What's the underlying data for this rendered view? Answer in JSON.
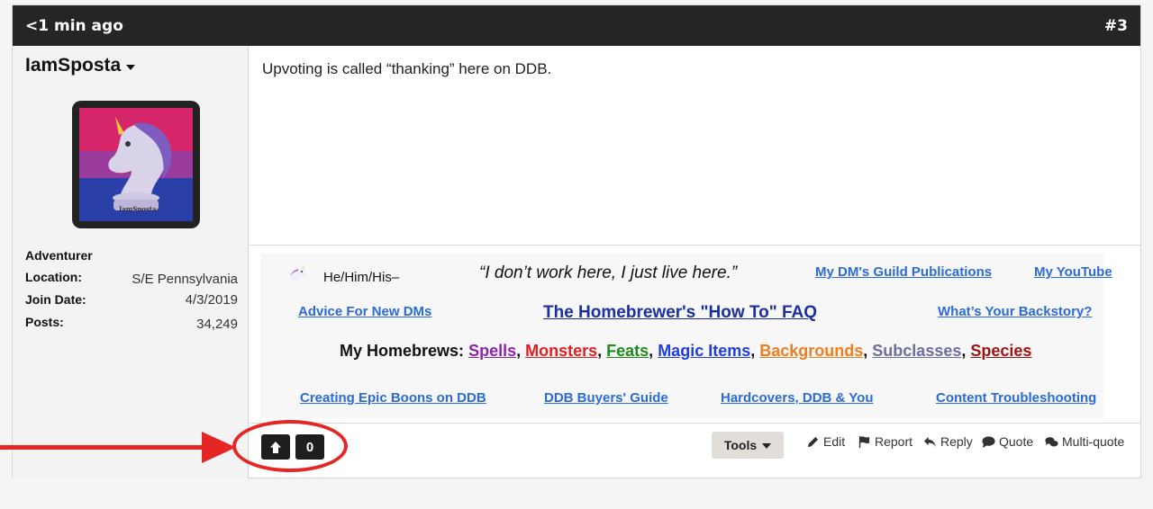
{
  "post": {
    "time": "<1 min ago",
    "number": "#3",
    "message": "Upvoting is called “thanking” here on DDB."
  },
  "author": {
    "username": "IamSposta",
    "avatar_caption": "IamSposta",
    "rank": "Adventurer",
    "stats": [
      {
        "label": "Location:",
        "value": "S/E Pennsylvania"
      },
      {
        "label": "Join Date:",
        "value": "4/3/2019"
      },
      {
        "label": "Posts:",
        "value": "34,249"
      }
    ]
  },
  "signature": {
    "pronouns_icon": "unicorn-emoji-icon",
    "pronouns": "He/Him/His–",
    "quote": "“I don’t work here, I just live here.”",
    "link_guild": "My DM's Guild Publications",
    "link_youtube": "My YouTube",
    "link_advice": "Advice For New DMs",
    "link_faq": "The Homebrewer's \"How To\" FAQ",
    "link_backstory": "What’s Your Backstory?",
    "homebrews_label": "My Homebrews:",
    "homebrews": [
      {
        "label": "Spells",
        "color": "#8e24aa",
        "sep": ", "
      },
      {
        "label": "Monsters",
        "color": "#e02020",
        "sep": ", "
      },
      {
        "label": "Feats",
        "color": "#1e8a1e",
        "sep": ", "
      },
      {
        "label": "Magic Items",
        "color": "#1e3ee0",
        "sep": ", "
      },
      {
        "label": "Backgrounds",
        "color": "#f07d1e",
        "sep": ", "
      },
      {
        "label": "Subclasses",
        "color": "#6e6e9e",
        "sep": ", "
      },
      {
        "label": "Species",
        "color": "#a01414",
        "sep": ""
      }
    ],
    "link_boons": "Creating Epic Boons on DDB",
    "link_buyers": "DDB Buyers' Guide",
    "link_hardcovers": "Hardcovers, DDB & You",
    "link_troubleshooting": "Content Troubleshooting"
  },
  "footer": {
    "upvote_icon": "arrow-up-icon",
    "vote_count": "0",
    "tools_label": "Tools",
    "actions": {
      "edit": "Edit",
      "report": "Report",
      "reply": "Reply",
      "quote": "Quote",
      "multiquote": "Multi-quote"
    }
  },
  "colors": {
    "header_bg": "#252525",
    "link": "#2b6bd6",
    "faq_link": "#1a2fa0",
    "annotation": "#e62525"
  }
}
